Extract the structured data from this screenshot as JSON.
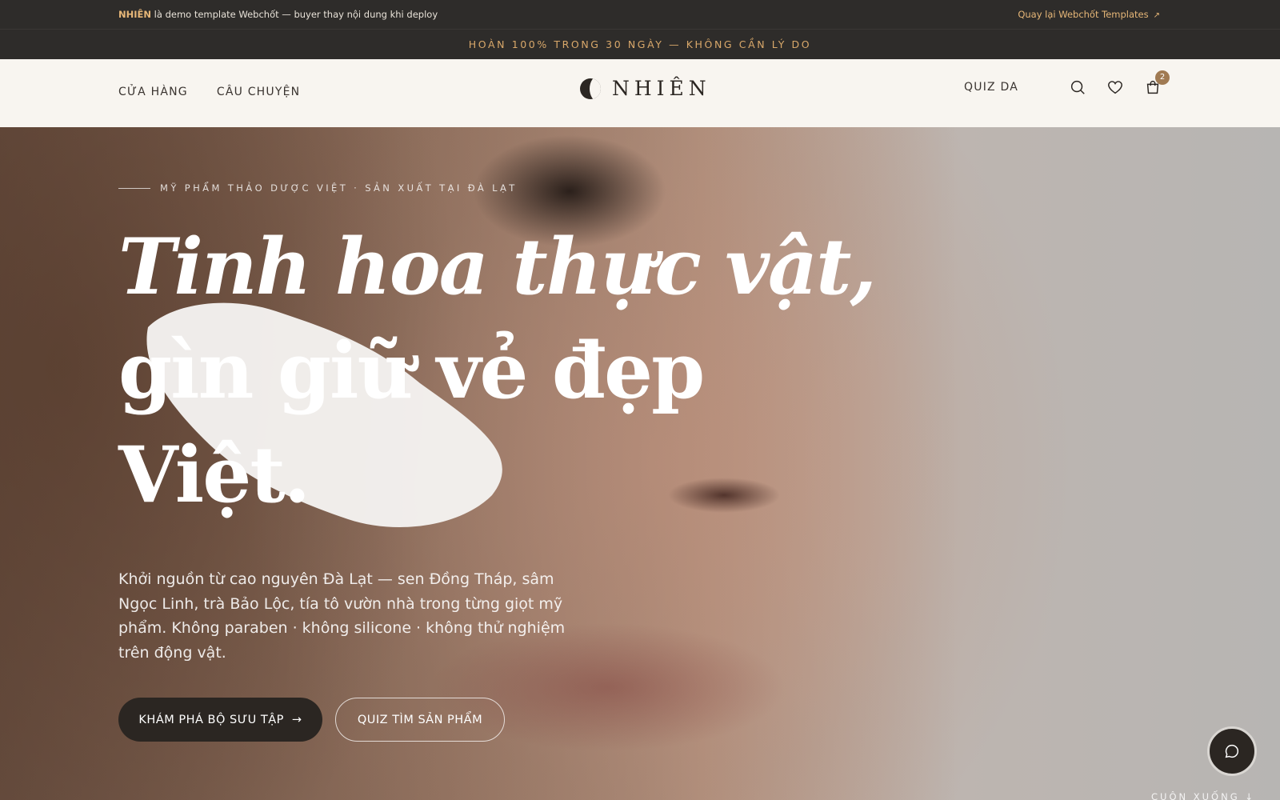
{
  "demo_bar": {
    "brand": "NHIÊN",
    "text": " là demo template Webchốt — buyer thay nội dung khi deploy",
    "back_link": "Quay lại Webchốt Templates",
    "back_icon": "arrow-up-right-icon"
  },
  "announcement": "HOÀN 100% TRONG 30 NGÀY — KHÔNG CẦN LÝ DO",
  "header": {
    "nav": [
      {
        "label": "CỬA HÀNG"
      },
      {
        "label": "CÂU CHUYỆN"
      }
    ],
    "logo_text": "NHIÊN",
    "quiz_label": "QUIZ DA",
    "icons": [
      "search-icon",
      "heart-icon",
      "cart-icon"
    ],
    "cart_count": "2"
  },
  "hero": {
    "eyebrow": "MỸ PHẨM THẢO DƯỢC VIỆT · SẢN XUẤT TẠI ĐÀ LẠT",
    "headline_line1": "Tinh hoa thực vật,",
    "headline_line2": "gìn giữ vẻ đẹp",
    "headline_line3": "Việt.",
    "description": "Khởi nguồn từ cao nguyên Đà Lạt — sen Đồng Tháp, sâm Ngọc Linh, trà Bảo Lộc, tía tô vườn nhà trong từng giọt mỹ phẩm. Không paraben · không silicone · không thử nghiệm trên động vật.",
    "primary_button": "KHÁM PHÁ BỘ SƯU TẬP",
    "secondary_button": "QUIZ TÌM SẢN PHẨM",
    "scroll_hint": "CUỘN XUỐNG"
  },
  "colors": {
    "dark": "#2b2622",
    "accent": "#d9a86a",
    "badge": "#a07a52",
    "header_bg": "#f8f5f0"
  }
}
